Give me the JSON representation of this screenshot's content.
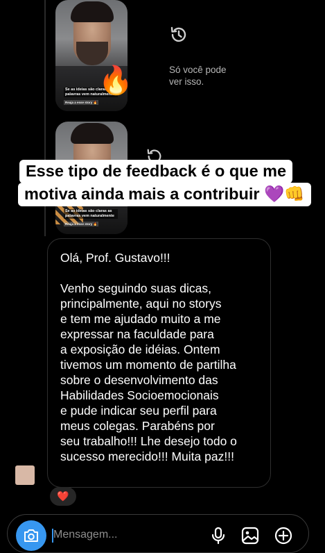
{
  "story_replies": [
    {
      "text_line1": "Se as ideias são claras as palavras vem naturalmente",
      "text_line2": "Reaja a esse story 🔥",
      "emoji": "🔥"
    },
    {
      "text_line1": "Se as ideias são claras as palavras vem naturalmente",
      "text_line2": "Reaja a esse story 🔥"
    }
  ],
  "expired_notice": {
    "icon": "history-icon",
    "text": "Só você pode\nver isso."
  },
  "banner": {
    "line1": "Esse tipo de feedback é o que me",
    "line2": "motiva ainda mais a contribuir 💜👊"
  },
  "message": {
    "text": "Olá, Prof. Gustavo!!!\n\nVenho seguindo suas dicas,\nprincipalmente, aqui no storys\ne tem me ajudado muito a me\nexpressar na faculdade para\na exposição de idéias. Ontem\ntivemos um momento de partilha\nsobre o desenvolvimento das\nHabilidades Socioemocionais\ne pude indicar seu perfil para\nmeus colegas. Parabéns por\nseu trabalho!!! Lhe desejo todo o\nsucesso merecido!!! Muita paz!!!"
  },
  "reaction": {
    "emoji": "❤️"
  },
  "composer": {
    "placeholder": "Mensagem...",
    "icons": [
      "camera-icon",
      "microphone-icon",
      "gallery-icon",
      "plus-circle-icon"
    ]
  },
  "colors": {
    "background": "#000000",
    "accent": "#3797f0",
    "banner_bg": "#ffffff",
    "secondary_text": "#b7b7b7"
  }
}
